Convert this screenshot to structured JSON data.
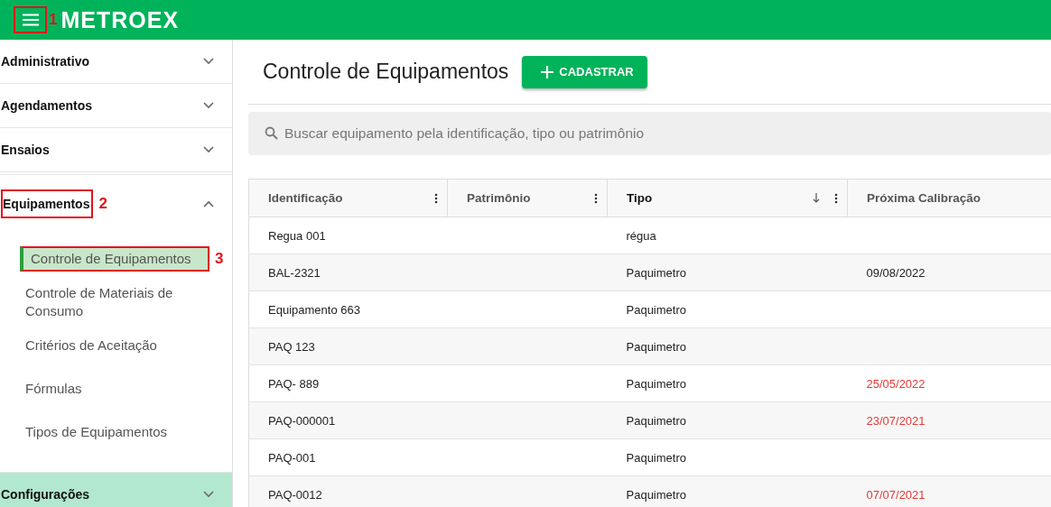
{
  "topbar": {
    "logo": "METROEX",
    "annotation": "1"
  },
  "sidebar": {
    "sections": [
      {
        "label": "Administrativo",
        "expanded": false,
        "highlighted": false
      },
      {
        "label": "Agendamentos",
        "expanded": false,
        "highlighted": false
      },
      {
        "label": "Ensaios",
        "expanded": false,
        "highlighted": false
      },
      {
        "label": "Equipamentos",
        "expanded": true,
        "highlighted": false,
        "annotation": "2",
        "children": [
          {
            "label": "Controle de Equipamentos",
            "selected": true,
            "annotation": "3"
          },
          {
            "label": "Controle de Materiais de Consumo",
            "selected": false
          },
          {
            "label": "Critérios de Aceitação",
            "selected": false
          },
          {
            "label": "Fórmulas",
            "selected": false
          },
          {
            "label": "Tipos de Equipamentos",
            "selected": false
          }
        ]
      },
      {
        "label": "Configurações",
        "expanded": false,
        "highlighted": true
      }
    ]
  },
  "page": {
    "title": "Controle de Equipamentos",
    "add_button": "CADASTRAR"
  },
  "search": {
    "placeholder": "Buscar equipamento pela identificação, tipo ou patrimônio"
  },
  "table": {
    "columns": [
      {
        "label": "Identificação",
        "sorted": false
      },
      {
        "label": "Patrimônio",
        "sorted": false
      },
      {
        "label": "Tipo",
        "sorted": true
      },
      {
        "label": "Próxima Calibração",
        "sorted": false
      }
    ],
    "rows": [
      {
        "identificacao": "Regua 001",
        "tipo": "régua"
      },
      {
        "identificacao": "BAL-2321",
        "tipo": "Paquimetro",
        "calibracao": "09/08/2022",
        "overdue": false
      },
      {
        "identificacao": "Equipamento 663",
        "tipo": "Paquimetro"
      },
      {
        "identificacao": "PAQ 123",
        "tipo": "Paquimetro"
      },
      {
        "identificacao": "PAQ- 889",
        "tipo": "Paquimetro",
        "calibracao": "25/05/2022",
        "overdue": true
      },
      {
        "identificacao": "PAQ-000001",
        "tipo": "Paquimetro",
        "calibracao": "23/07/2021",
        "overdue": true
      },
      {
        "identificacao": "PAQ-001",
        "tipo": "Paquimetro"
      },
      {
        "identificacao": "PAQ-0012",
        "tipo": "Paquimetro",
        "calibracao": "07/07/2021",
        "overdue": true
      }
    ]
  }
}
